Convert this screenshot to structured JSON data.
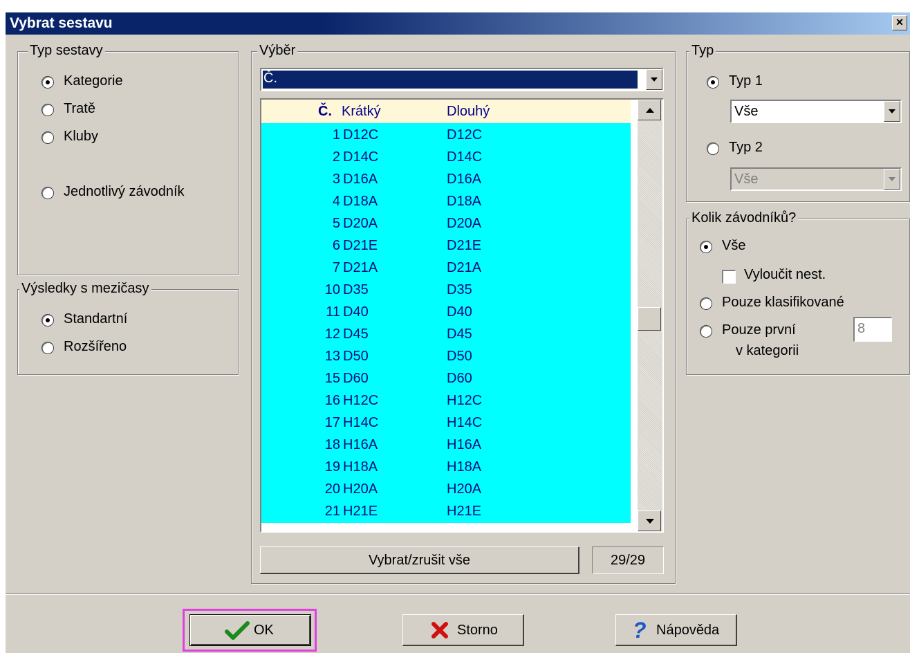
{
  "window": {
    "title": "Vybrat sestavu",
    "close_glyph": "×"
  },
  "typ_sestavy": {
    "legend": "Typ sestavy",
    "options": [
      {
        "label": "Kategorie",
        "checked": true
      },
      {
        "label": "Tratě",
        "checked": false
      },
      {
        "label": "Kluby",
        "checked": false
      },
      {
        "label": "Jednotlivý závodník",
        "checked": false
      }
    ]
  },
  "vysledky": {
    "legend": "Výsledky s mezičasy",
    "options": [
      {
        "label": "Standartní",
        "checked": true
      },
      {
        "label": "Rozšířeno",
        "checked": false
      }
    ]
  },
  "vyber": {
    "legend": "Výběr",
    "sort_combo": "Č.",
    "columns": {
      "num": "Č.",
      "short": "Krátký",
      "long": "Dlouhý"
    },
    "rows": [
      {
        "num": "1",
        "short": "D12C",
        "long": "D12C"
      },
      {
        "num": "2",
        "short": "D14C",
        "long": "D14C"
      },
      {
        "num": "3",
        "short": "D16A",
        "long": "D16A"
      },
      {
        "num": "4",
        "short": "D18A",
        "long": "D18A"
      },
      {
        "num": "5",
        "short": "D20A",
        "long": "D20A"
      },
      {
        "num": "6",
        "short": "D21E",
        "long": "D21E"
      },
      {
        "num": "7",
        "short": "D21A",
        "long": "D21A"
      },
      {
        "num": "10",
        "short": "D35",
        "long": "D35"
      },
      {
        "num": "11",
        "short": "D40",
        "long": "D40"
      },
      {
        "num": "12",
        "short": "D45",
        "long": "D45"
      },
      {
        "num": "13",
        "short": "D50",
        "long": "D50"
      },
      {
        "num": "15",
        "short": "D60",
        "long": "D60"
      },
      {
        "num": "16",
        "short": "H12C",
        "long": "H12C"
      },
      {
        "num": "17",
        "short": "H14C",
        "long": "H14C"
      },
      {
        "num": "18",
        "short": "H16A",
        "long": "H16A"
      },
      {
        "num": "19",
        "short": "H18A",
        "long": "H18A"
      },
      {
        "num": "20",
        "short": "H20A",
        "long": "H20A"
      },
      {
        "num": "21",
        "short": "H21E",
        "long": "H21E"
      }
    ],
    "select_all_label": "Vybrat/zrušit vše",
    "count": "29/29"
  },
  "typ": {
    "legend": "Typ",
    "typ1_label": "Typ 1",
    "typ1_value": "Vše",
    "typ2_label": "Typ 2",
    "typ2_value": "Vše"
  },
  "kolik": {
    "legend": "Kolik závodníků?",
    "vse_label": "Vše",
    "vyloucit_label": "Vyloučit nest.",
    "klasif_label": "Pouze klasifikované",
    "prvni_label1": "Pouze první",
    "prvni_label2": "v kategorii",
    "prvni_value": "8"
  },
  "buttons": {
    "ok": "OK",
    "storno": "Storno",
    "help": "Nápověda"
  },
  "colors": {
    "list_bg": "#00ffff",
    "header_bg": "#fff8d8",
    "title_bar": "#0a246a",
    "focus_frame": "#e040e0"
  }
}
